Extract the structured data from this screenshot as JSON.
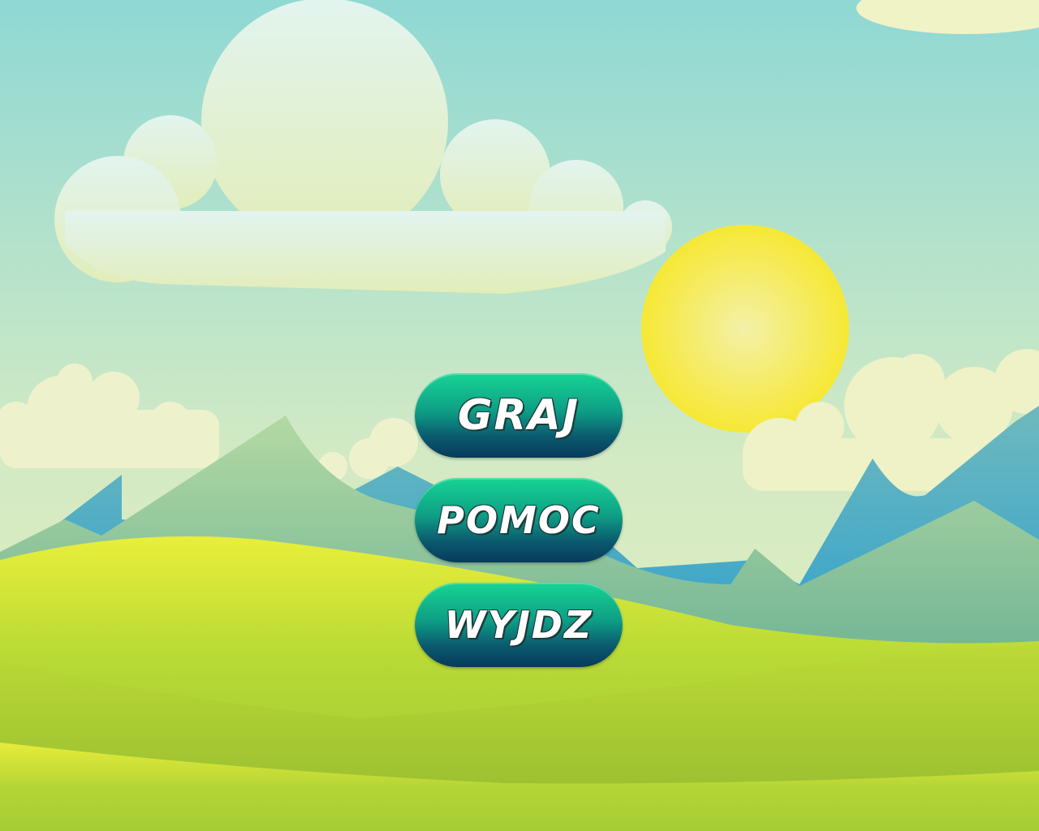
{
  "menu": {
    "play_label": "GRAJ",
    "help_label": "POMOC",
    "exit_label": "WYJDZ"
  },
  "colors": {
    "sky_top": "#8fd8d4",
    "sky_bottom": "#dfeebe",
    "sun": "#f5e63c",
    "button_top": "#17d494",
    "button_bottom": "#083a5c",
    "grass": "#b2d535"
  }
}
